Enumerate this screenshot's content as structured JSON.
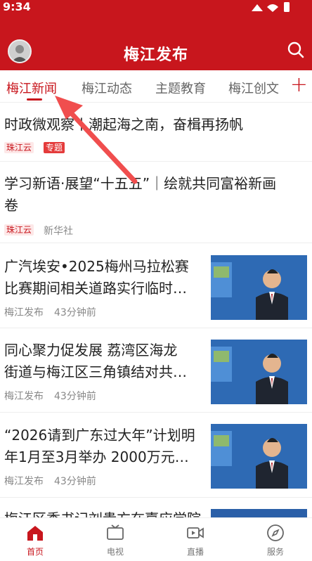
{
  "status_bar": {
    "time": "9:34"
  },
  "header": {
    "title": "梅江发布"
  },
  "tabs": [
    {
      "label": "梅江新闻"
    },
    {
      "label": "梅江动态"
    },
    {
      "label": "主题教育"
    },
    {
      "label": "梅江创文"
    }
  ],
  "tabs_add_label": "+",
  "feed": [
    {
      "title": "时政微观察丨潮起海之南，奋楫再扬帆",
      "tag1": "珠江云",
      "tag2": "专题"
    },
    {
      "title_line1": "学习新语·展望“十五五”｜绘就共同富裕新画",
      "title_line2": "卷",
      "tag1": "珠江云",
      "source": "新华社"
    },
    {
      "title_line1": "广汽埃安•2025梅州马拉松赛",
      "title_line2": "比赛期间相关道路实行临时…",
      "source": "梅江发布",
      "time": "43分钟前"
    },
    {
      "title_line1": "同心聚力促发展 荔湾区海龙",
      "title_line2": "街道与梅江区三角镇结对共…",
      "source": "梅江发布",
      "time": "43分钟前"
    },
    {
      "title_line1": "“2026请到广东过大年”计划明",
      "title_line2": "年1月至3月举办 2000万元…",
      "source": "梅江发布",
      "time": "43分钟前"
    },
    {
      "title_line1": "梅江区委书记刘贵方在嘉应学院"
    }
  ],
  "bottom_nav": [
    {
      "label": "首页"
    },
    {
      "label": "电视"
    },
    {
      "label": "直播"
    },
    {
      "label": "服务"
    }
  ],
  "colors": {
    "brand": "#c8161d",
    "annotation_arrow": "#f04e4e"
  }
}
